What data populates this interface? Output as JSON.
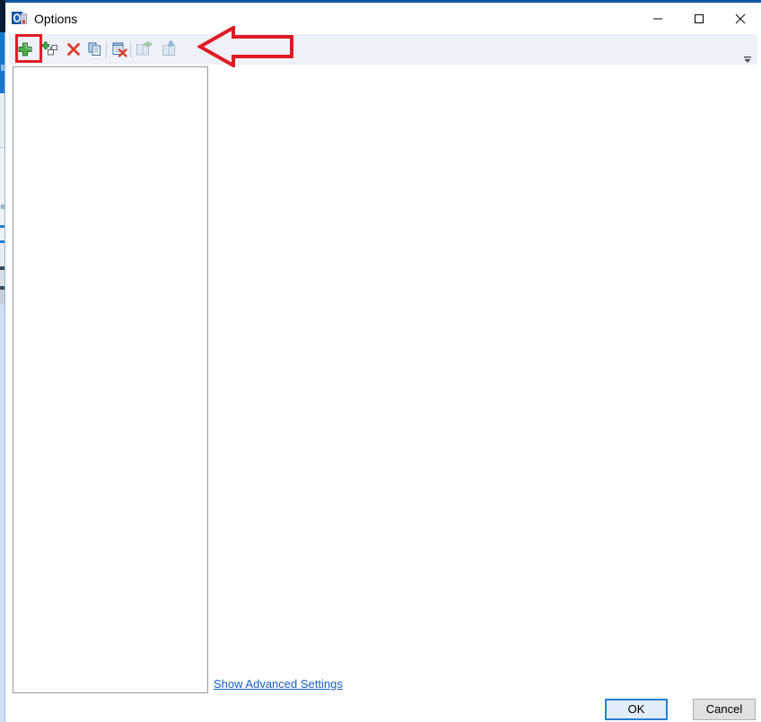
{
  "window": {
    "title": "Options",
    "app_icon": "outlook-options-icon",
    "accent_color": "#0d56a6",
    "controls": {
      "minimize": "minimize-icon",
      "maximize": "maximize-icon",
      "close": "close-icon"
    }
  },
  "toolbar": {
    "background_color": "#eef1f7",
    "buttons": [
      {
        "name": "add-account-button",
        "icon": "green-plus-icon",
        "enabled": true,
        "highlighted": true
      },
      {
        "name": "new-account-group-button",
        "icon": "green-plus-nodes-icon",
        "enabled": true,
        "highlighted": false
      },
      {
        "name": "remove-button",
        "icon": "red-x-icon",
        "enabled": true,
        "highlighted": false
      },
      {
        "name": "copy-button",
        "icon": "copy-pages-icon",
        "enabled": true,
        "highlighted": false
      },
      {
        "name": "clear-button",
        "icon": "page-red-x-icon",
        "enabled": true,
        "highlighted": false
      },
      {
        "name": "export-button",
        "icon": "grid-green-arrow-out-icon",
        "enabled": false,
        "highlighted": false
      },
      {
        "name": "import-button",
        "icon": "grid-blue-arrow-down-icon",
        "enabled": false,
        "highlighted": false
      }
    ],
    "overflow_icon": "toolbar-overflow-chevron-icon"
  },
  "annotations": {
    "highlight_color": "#e01b24",
    "box_target": "add-account-button",
    "arrow_direction": "left",
    "arrow_style": "outline"
  },
  "main": {
    "list_panel": {
      "name": "accounts-list",
      "items": [],
      "empty": true
    },
    "detail_panel": {
      "name": "settings-detail-pane",
      "content": ""
    },
    "advanced_link_label": "Show Advanced Settings",
    "advanced_link_color": "#1961c0"
  },
  "footer": {
    "ok_label": "OK",
    "cancel_label": "Cancel",
    "focused_button": "OK",
    "focus_color": "#2a7fd0"
  }
}
